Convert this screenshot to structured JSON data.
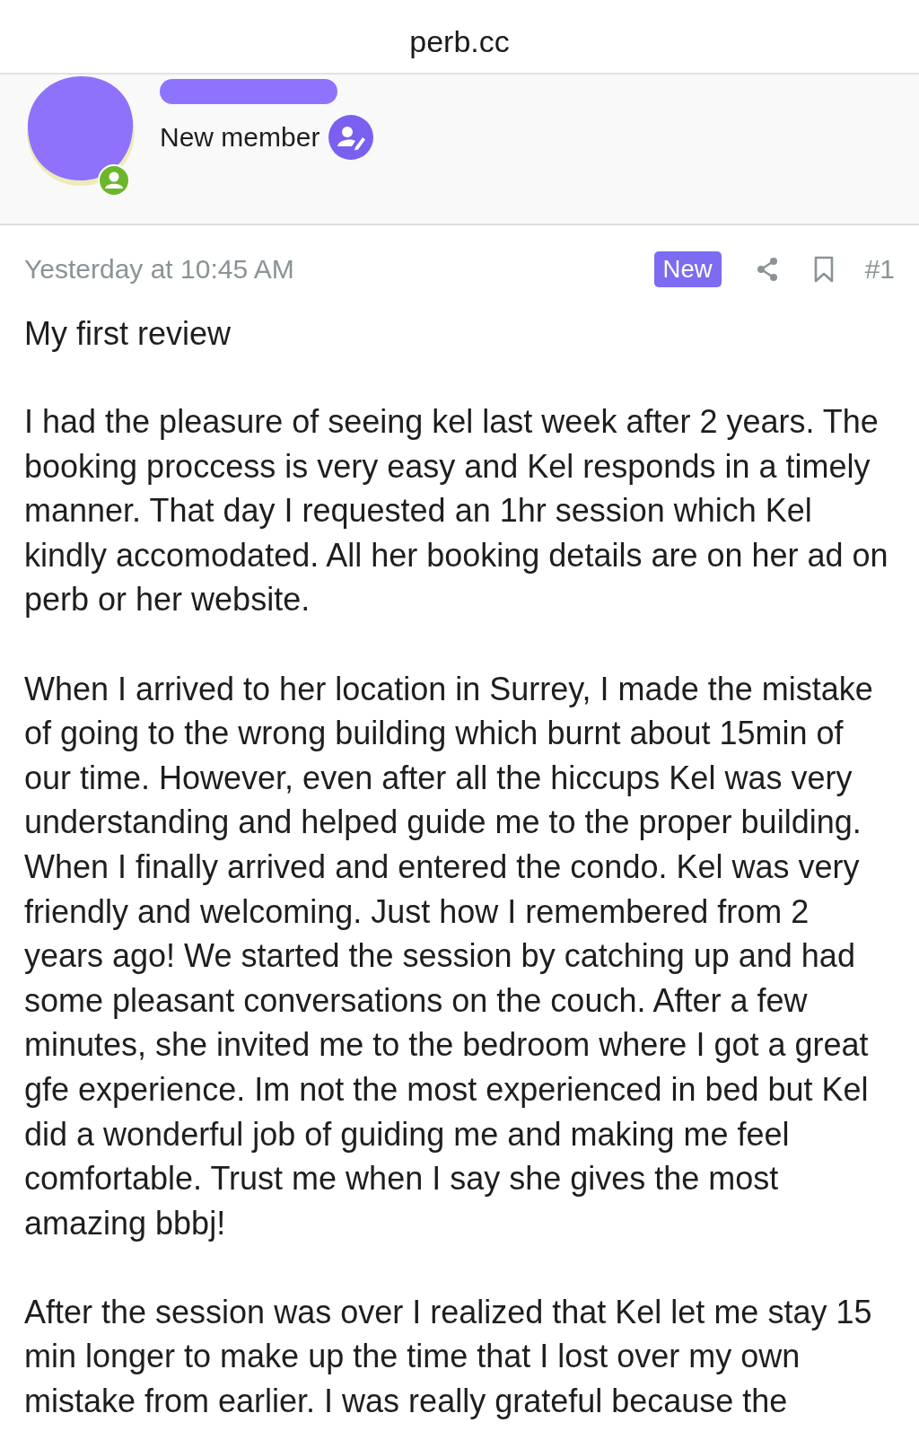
{
  "browser_bar": {
    "address": "perb.cc"
  },
  "author": {
    "role": "New member"
  },
  "post": {
    "timestamp": "Yesterday at 10:45 AM",
    "badge": "New",
    "number": "#1",
    "title": "My first review",
    "paragraphs": [
      "I had the pleasure of seeing kel last week after 2 years. The booking proccess is very easy and Kel responds in a timely manner. That day I requested an 1hr session which Kel kindly accomodated. All her booking details are on her ad on perb or her website.",
      "When I arrived to her location in Surrey, I made the mistake of going to the wrong building which burnt about 15min of our time. However, even after all the hiccups Kel was very understanding and helped guide me to the proper building. When I finally arrived and entered the condo. Kel was very friendly and welcoming. Just how I remembered from 2 years ago! We started the session by catching up and had some pleasant conversations on the couch. After a few minutes, she invited me to the bedroom where I got a great gfe experience. Im not the most experienced in bed but Kel did a wonderful job of guiding me and making me feel comfortable. Trust me when I say she gives the most amazing bbbj!",
      "After the session was over I realized that Kel let me stay 15 min longer to make up the time that I lost over my own mistake from earlier. I was really grateful because the"
    ]
  }
}
